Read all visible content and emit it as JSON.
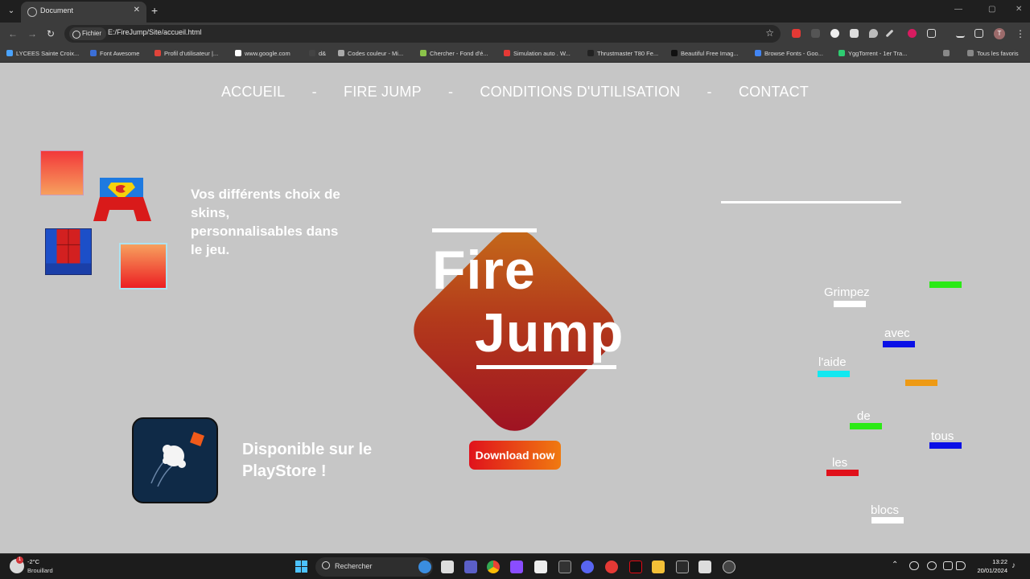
{
  "browser": {
    "tab_title": "Document",
    "tab_close": "✕",
    "new_tab": "+",
    "site_chip": "Fichier",
    "url": "E:/FireJump/Site/accueil.html",
    "back": "←",
    "forward": "→",
    "reload": "↻",
    "bookmark_star": "☆",
    "minimize": "—",
    "maximize": "▢",
    "close": "✕",
    "profile_initial": "T",
    "bookmarks": [
      {
        "label": "LYCEES Sainte Croix...",
        "color": "#4aa3ff"
      },
      {
        "label": "Font Awesome",
        "color": "#3b6fd8"
      },
      {
        "label": "Profil d'utilisateur |...",
        "color": "#e0443a"
      },
      {
        "label": "www.google.com",
        "color": "#ffffff"
      },
      {
        "label": "d&",
        "color": "#444444"
      },
      {
        "label": "Codes couleur - Mi...",
        "color": "#aaaaaa"
      },
      {
        "label": "Chercher - Fond d'é...",
        "color": "#8bc34a"
      },
      {
        "label": "Simulation auto . W...",
        "color": "#e53935"
      },
      {
        "label": "Thrustmaster T80 Fe...",
        "color": "#222222"
      },
      {
        "label": "Beautiful Free Imag...",
        "color": "#111111"
      },
      {
        "label": "Browse Fonts - Goo...",
        "color": "#4285f4"
      },
      {
        "label": "YggTorrent - 1er Tra...",
        "color": "#2ecc71"
      }
    ],
    "bookmarks_overflow": "»",
    "all_bookmarks": "Tous les favoris"
  },
  "nav": {
    "items": [
      "ACCUEIL",
      "FIRE JUMP",
      "CONDITIONS D'UTILISATION",
      "CONTACT"
    ],
    "separator": "-"
  },
  "skins": {
    "text": "Vos différents choix de skins, personnalisables dans le jeu."
  },
  "logo": {
    "line1": "Fire",
    "line2": "Jump"
  },
  "download": {
    "label": "Download now"
  },
  "store": {
    "text": "Disponible sur le PlayStore !"
  },
  "word_blocks": [
    {
      "word": "Grimpez",
      "color": "#ffffff"
    },
    {
      "word": "avec",
      "color": "#0a10e6"
    },
    {
      "word": "l'aide",
      "color": "#11e8f0"
    },
    {
      "word": "de",
      "color": "#2bea16"
    },
    {
      "word": "tous",
      "color": "#0a10e6"
    },
    {
      "word": "les",
      "color": "#e0101a"
    },
    {
      "word": "blocs",
      "color": "#ffffff"
    }
  ],
  "extra_blocks": [
    {
      "color": "#2bea16"
    },
    {
      "color": "#ee9a14"
    }
  ],
  "taskbar": {
    "notification_count": "1",
    "weather_temp": "-2°C",
    "weather_desc": "Brouillard",
    "search_label": "Rechercher",
    "time": "13:22",
    "date": "20/01/2024"
  }
}
